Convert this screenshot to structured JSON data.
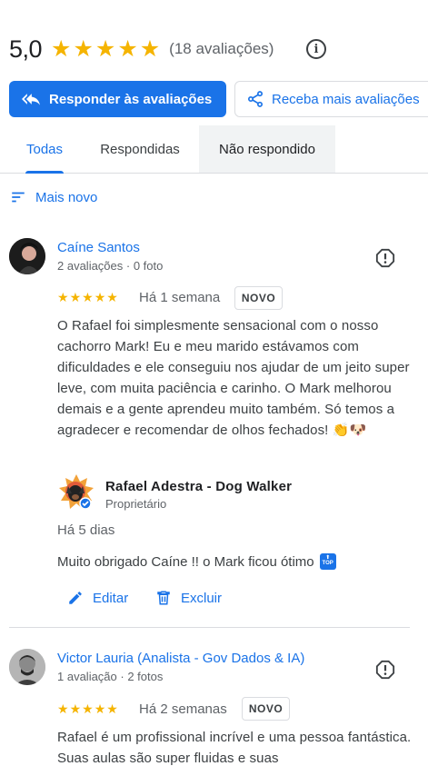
{
  "summary": {
    "score": "5,0",
    "star_count": 5,
    "count_text": "(18 avaliações)"
  },
  "actions": {
    "reply_label": "Responder às avaliações",
    "get_more_label": "Receba mais avaliações"
  },
  "tabs": [
    {
      "label": "Todas",
      "selected": true
    },
    {
      "label": "Respondidas",
      "selected": false
    },
    {
      "label": "Não respondido",
      "selected": false
    }
  ],
  "sort": {
    "label": "Mais novo"
  },
  "reviews": [
    {
      "name": "Caíne Santos",
      "meta": "2 avaliações · 0 foto",
      "rating": 5,
      "date": "Há 1 semana",
      "badge": "NOVO",
      "text": "O Rafael foi simplesmente sensacional com o nosso cachorro Mark! Eu e meu marido estávamos com dificuldades e ele conseguiu nos ajudar de um jeito super leve, com muita paciência e carinho. O Mark melhorou demais e a gente aprendeu muito também. Só temos a agradecer e recomendar de olhos fechados! 👏🐶",
      "reply": {
        "owner_name": "Rafael Adestra - Dog Walker",
        "owner_role": "Proprietário",
        "date": "Há 5 dias",
        "text": "Muito obrigado Caíne !! o Mark ficou ótimo",
        "emoji_label": "TOP",
        "edit_label": "Editar",
        "delete_label": "Excluir"
      }
    },
    {
      "name": "Victor Lauria (Analista - Gov Dados & IA)",
      "meta": "1 avaliação · 2 fotos",
      "rating": 5,
      "date": "Há 2 semanas",
      "badge": "NOVO",
      "text": "Rafael é um profissional incrível e uma pessoa fantástica. Suas aulas são super fluidas e suas"
    }
  ],
  "colors": {
    "accent": "#1a73e8",
    "star": "#f5b400",
    "text": "#202124",
    "muted": "#5f6368",
    "divider": "#dadce0"
  }
}
